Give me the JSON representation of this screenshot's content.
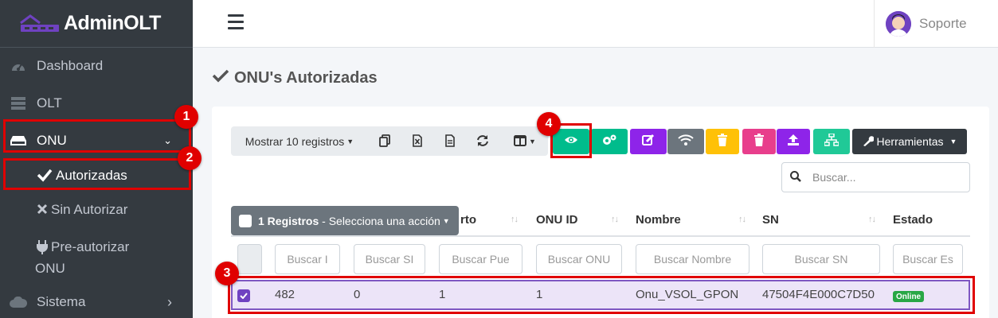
{
  "brand": {
    "name": "AdminOLT"
  },
  "sidebar": {
    "items": [
      {
        "label": "Dashboard",
        "icon": "tachometer-icon"
      },
      {
        "label": "OLT",
        "icon": "server-icon"
      },
      {
        "label": "ONU",
        "icon": "hdd-icon",
        "chevron": "⌄"
      },
      {
        "label": "Sistema",
        "icon": "cloud-icon",
        "chevron": "›"
      }
    ],
    "subitems": [
      {
        "label": "Autorizadas",
        "icon": "check-icon"
      },
      {
        "label": "Sin Autorizar",
        "icon": "times-icon"
      },
      {
        "label_line1": "Pre-autorizar",
        "label_line2": "ONU",
        "icon": "plug-icon"
      }
    ]
  },
  "topbar": {
    "user_name": "Soporte"
  },
  "page": {
    "title": "ONU's Autorizadas"
  },
  "toolbar": {
    "show_records": "Mostrar 10 registros",
    "tools_label": "Herramientas",
    "colors": {
      "view": "#00bc8c",
      "config": "#00bc8c",
      "edit": "#8e24e9",
      "wifi": "#6c757d",
      "delete_yellow": "#ffc107",
      "delete_pink": "#e83e8c",
      "upload": "#8e24e9",
      "network": "#20c997",
      "tools": "#343a40"
    }
  },
  "search": {
    "placeholder": "Buscar..."
  },
  "bulk_action": {
    "count": "1 Registros",
    "label": " - Selecciona una acción"
  },
  "table": {
    "headers": [
      "rto",
      "ONU ID",
      "Nombre",
      "SN",
      "Estado"
    ],
    "filters": [
      "Buscar I",
      "Buscar SI",
      "Buscar Pue",
      "Buscar ONU",
      "Buscar Nombre",
      "Buscar SN",
      "Buscar Es"
    ],
    "row": [
      "482",
      "0",
      "1",
      "1",
      "Onu_VSOL_GPON",
      "47504F4E000C7D50"
    ],
    "row_status": "Online",
    "selected_row_color": "#ece4f8"
  },
  "annotations": {
    "markers": [
      "1",
      "2",
      "3",
      "4"
    ],
    "color": "#e00000"
  }
}
